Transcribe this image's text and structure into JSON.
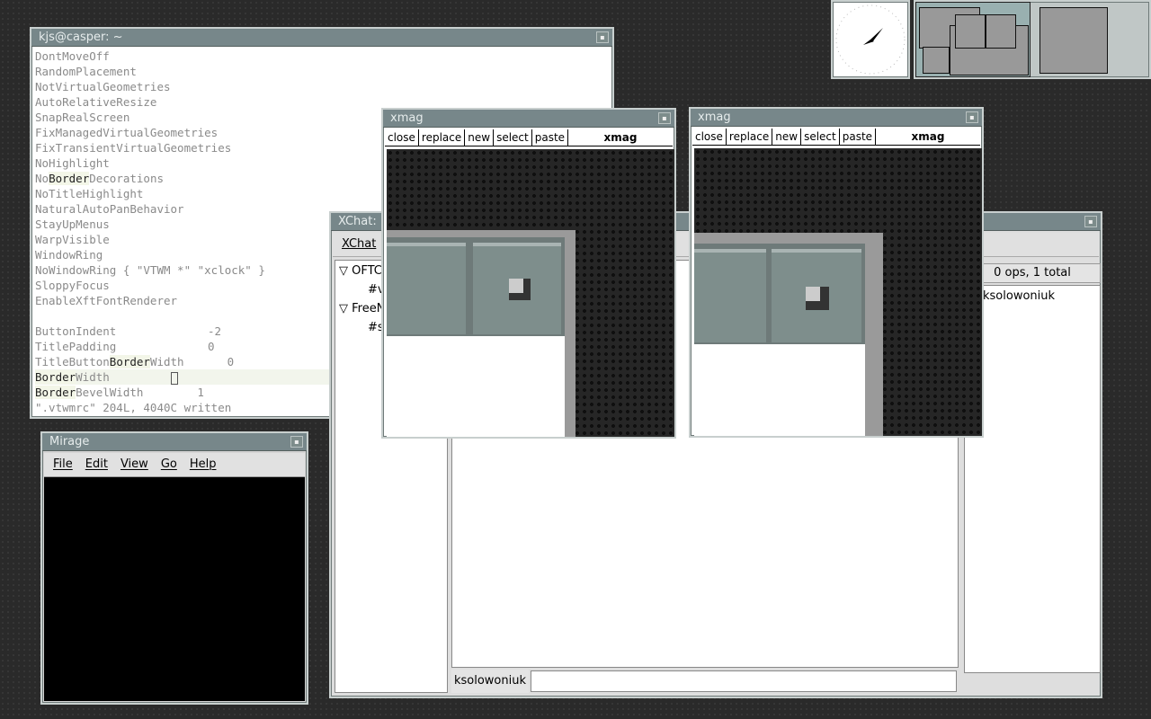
{
  "terminal": {
    "title": "kjs@casper: ~",
    "lines": [
      "DontMoveOff",
      "RandomPlacement",
      "NotVirtualGeometries",
      "AutoRelativeResize",
      "SnapRealScreen",
      "FixManagedVirtualGeometries",
      "FixTransientVirtualGeometries",
      "NoHighlight"
    ],
    "l9a": "No",
    "l9b": "Border",
    "l9c": "Decorations",
    "lines2": [
      "NoTitleHighlight",
      "NaturalAutoPanBehavior",
      "StayUpMenus",
      "WarpVisible",
      "WindowRing",
      "NoWindowRing { \"VTWM *\" \"xclock\" }",
      "SloppyFocus",
      "EnableXftFontRenderer"
    ],
    "buttonindent_key": "ButtonIndent",
    "buttonindent_val": "-2",
    "titlepadding_key": "TitlePadding",
    "titlepadding_val": "0",
    "tbbw_a": "TitleButton",
    "tbbw_b": "Border",
    "tbbw_c": "Width",
    "tbbw_val": "0",
    "bw_a": "Border",
    "bw_b": "Width",
    "bbw_a": "Border",
    "bbw_b": "BevelWidth",
    "bbw_val": "1",
    "status": "\".vtwmrc\" 204L, 4040C written"
  },
  "mirage": {
    "title": "Mirage",
    "menu": [
      "File",
      "Edit",
      "View",
      "Go",
      "Help"
    ]
  },
  "xchat": {
    "title": "XChat:",
    "menu": "XChat",
    "tree": [
      {
        "label": "OFTC",
        "child": "#v"
      },
      {
        "label": "FreeN",
        "child": "#s"
      }
    ],
    "ops": "0 ops, 1 total",
    "user": "ksolowoniuk",
    "nick": "ksolowoniuk"
  },
  "xmag1": {
    "title": "xmag",
    "buttons": [
      "close",
      "replace",
      "new",
      "select",
      "paste"
    ],
    "label": "xmag"
  },
  "xmag2": {
    "title": "xmag",
    "buttons": [
      "close",
      "replace",
      "new",
      "select",
      "paste"
    ],
    "label": "xmag"
  }
}
